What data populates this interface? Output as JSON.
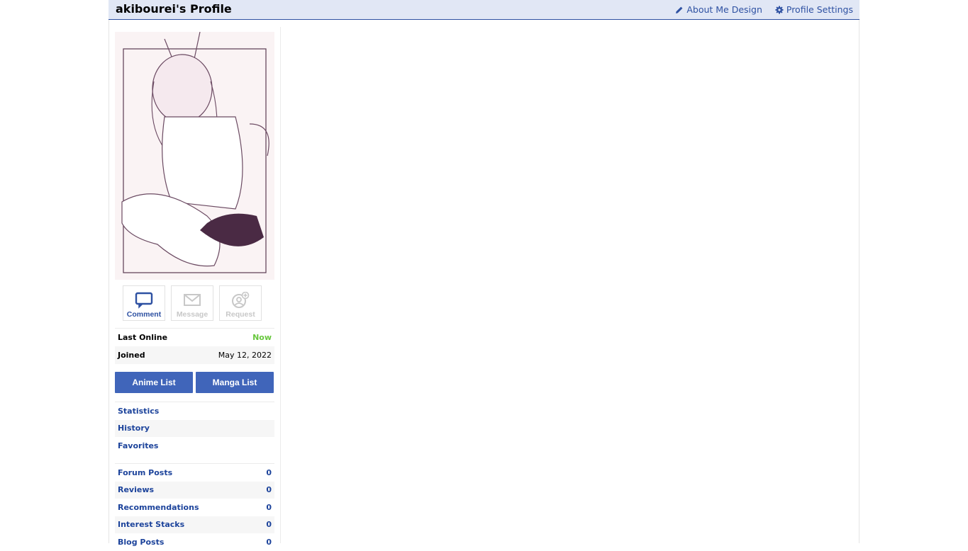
{
  "header": {
    "title": "akibourei's Profile",
    "about_me_design": "About Me Design",
    "profile_settings": "Profile Settings"
  },
  "actions": {
    "comment": "Comment",
    "message": "Message",
    "request": "Request"
  },
  "info": {
    "last_online_label": "Last Online",
    "last_online_value": "Now",
    "joined_label": "Joined",
    "joined_value": "May 12, 2022"
  },
  "lists": {
    "anime": "Anime List",
    "manga": "Manga List"
  },
  "nav": {
    "statistics": "Statistics",
    "history": "History",
    "favorites": "Favorites"
  },
  "stats": [
    {
      "label": "Forum Posts",
      "value": "0"
    },
    {
      "label": "Reviews",
      "value": "0"
    },
    {
      "label": "Recommendations",
      "value": "0"
    },
    {
      "label": "Interest Stacks",
      "value": "0"
    },
    {
      "label": "Blog Posts",
      "value": "0"
    }
  ],
  "colors": {
    "accent": "#2e51a2",
    "header_bg": "#e1e7f5",
    "button": "#4065ba",
    "online": "#68c73e"
  },
  "icons": [
    "pencil-icon",
    "gear-icon",
    "comment-icon",
    "message-icon",
    "request-icon"
  ]
}
